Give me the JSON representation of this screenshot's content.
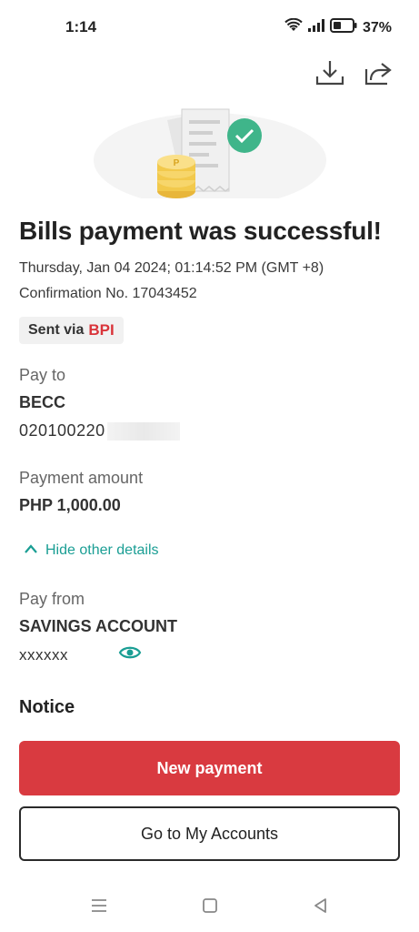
{
  "status_bar": {
    "time": "1:14",
    "battery": "37%",
    "icons": [
      "wifi-icon",
      "signal-icon",
      "battery-icon"
    ]
  },
  "toolbar": {
    "icons": [
      "download-icon",
      "share-icon"
    ]
  },
  "hero": {
    "icons": [
      "receipt-icon",
      "coins-icon",
      "check-icon"
    ]
  },
  "receipt": {
    "title": "Bills payment was successful!",
    "date": "Thursday, Jan 04 2024; 01:14:52 PM (GMT +8)",
    "confirmation": "Confirmation No. 17043452",
    "sent_via_label": "Sent via",
    "sent_via_bank": "BPI"
  },
  "pay_to": {
    "label": "Pay to",
    "biller": "BECC",
    "account_no": "020100220"
  },
  "amount": {
    "label": "Payment amount",
    "value": "PHP 1,000.00"
  },
  "details_toggle": {
    "label": "Hide other details"
  },
  "pay_from": {
    "label": "Pay from",
    "account_type": "SAVINGS ACCOUNT",
    "masked_number": "xxxxxx"
  },
  "notice": {
    "label": "Notice"
  },
  "actions": {
    "primary": "New payment",
    "secondary": "Go to My Accounts"
  },
  "colors": {
    "accent": "#d93a40",
    "teal": "#1a9e94",
    "success": "#3fb58a"
  }
}
